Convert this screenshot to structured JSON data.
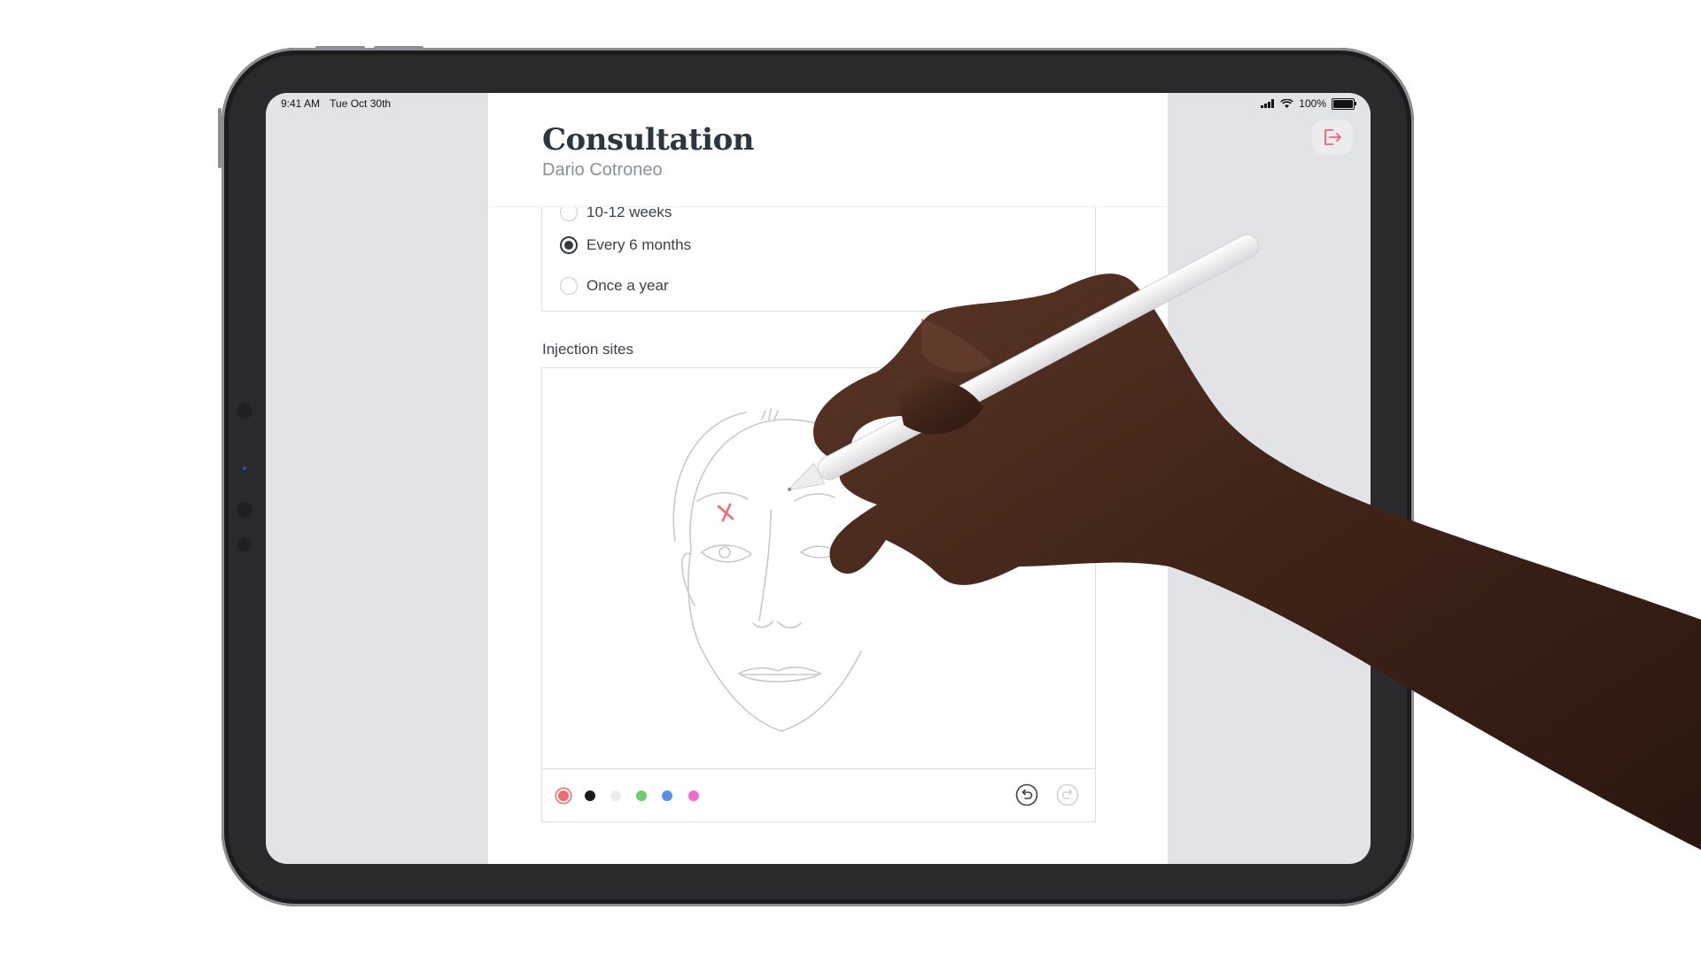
{
  "status_bar": {
    "time": "9:41 AM",
    "date": "Tue Oct 30th",
    "battery": "100%"
  },
  "header": {
    "title": "Consultation",
    "subtitle": "Dario Cotroneo"
  },
  "frequency_options": [
    {
      "label": "10-12 weeks",
      "selected": false
    },
    {
      "label": "Every 6 months",
      "selected": true
    },
    {
      "label": "Once a year",
      "selected": false
    }
  ],
  "injection": {
    "label": "Injection sites",
    "colors": [
      "#f06b6b",
      "#1c1c1e",
      "#ececee",
      "#6dcf68",
      "#5b8ee8",
      "#ee6bd0"
    ],
    "selected_color": "#f06b6b"
  },
  "icons": {
    "exit": "exit-icon",
    "undo": "undo-icon",
    "redo": "redo-icon"
  }
}
